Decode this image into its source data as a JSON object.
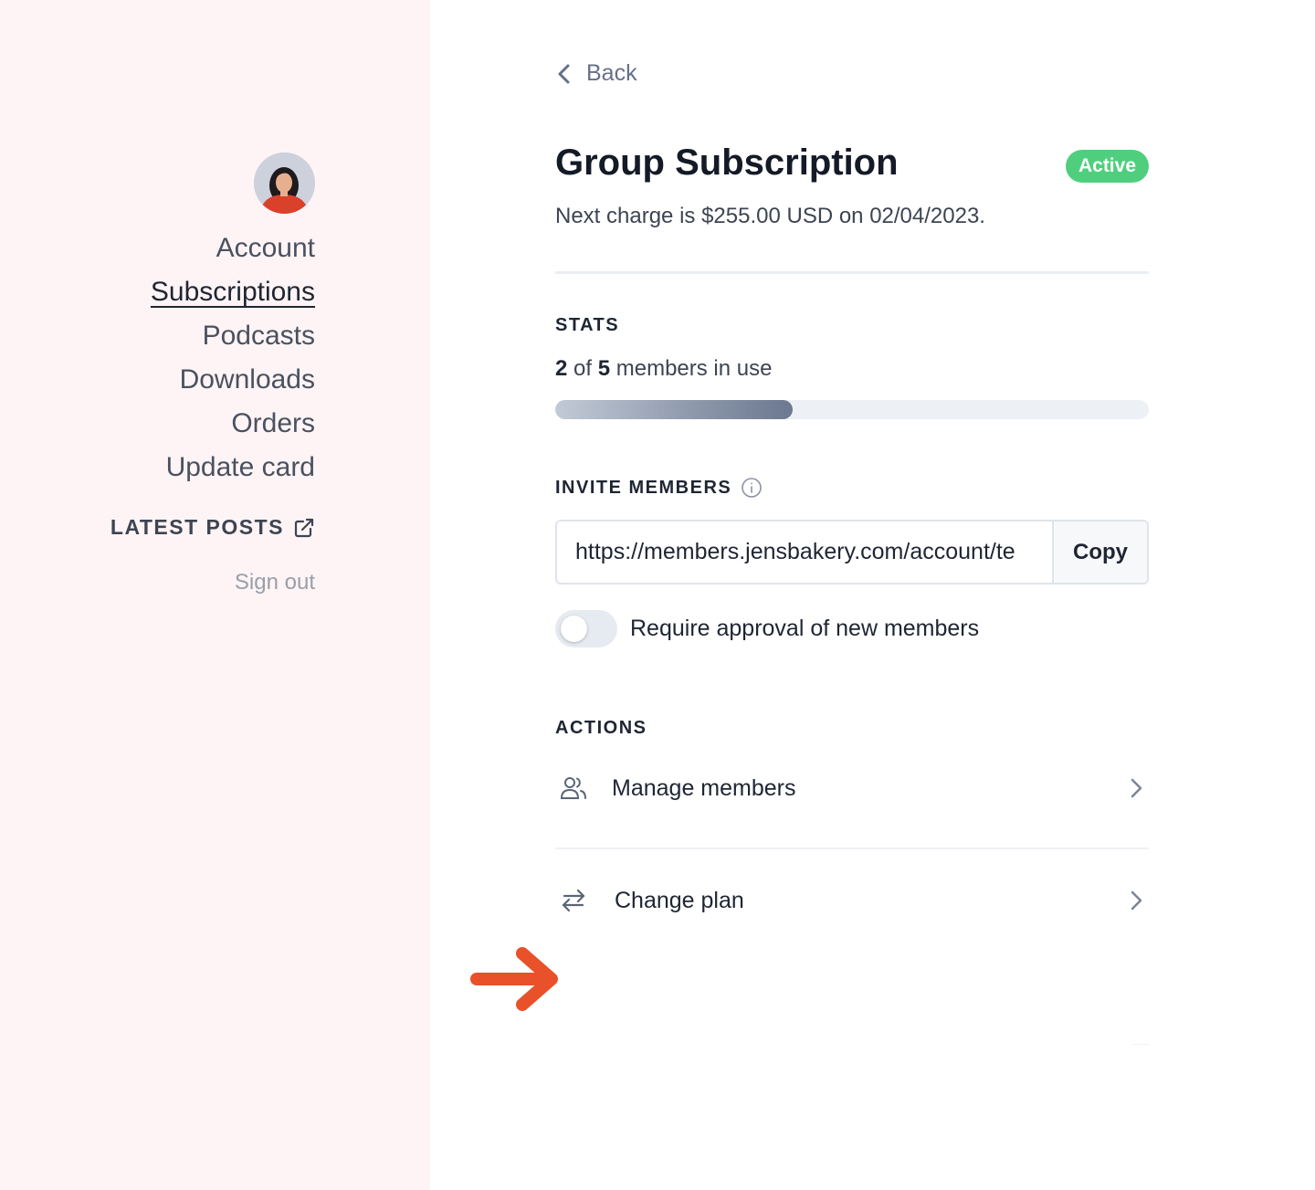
{
  "sidebar": {
    "avatar_alt": "",
    "nav": [
      {
        "label": "Account",
        "active": false
      },
      {
        "label": "Subscriptions",
        "active": true
      },
      {
        "label": "Podcasts",
        "active": false
      },
      {
        "label": "Downloads",
        "active": false
      },
      {
        "label": "Orders",
        "active": false
      },
      {
        "label": "Update card",
        "active": false
      }
    ],
    "latest_posts": "LATEST POSTS",
    "sign_out": "Sign out"
  },
  "main": {
    "back_label": "Back",
    "title": "Group Subscription",
    "status_badge": "Active",
    "next_charge": "Next charge is $255.00 USD on 02/04/2023.",
    "stats": {
      "label": "STATS",
      "used": "2",
      "of_text": " of ",
      "total": "5",
      "suffix": " members in use",
      "progress_fraction": 0.4
    },
    "invite": {
      "label": "INVITE MEMBERS",
      "url": "https://members.jensbakery.com/account/te",
      "copy_label": "Copy"
    },
    "approval_toggle": {
      "label": "Require approval of new members",
      "on": false
    },
    "actions": {
      "label": "ACTIONS",
      "items": [
        {
          "label": "Manage members",
          "icon": "users-icon"
        },
        {
          "label": "Change plan",
          "icon": "swap-arrows-icon"
        }
      ]
    }
  },
  "colors": {
    "sidebar_bg": "#fef4f5",
    "badge_green": "#4fcf7e",
    "annotation_arrow": "#e8512a"
  }
}
